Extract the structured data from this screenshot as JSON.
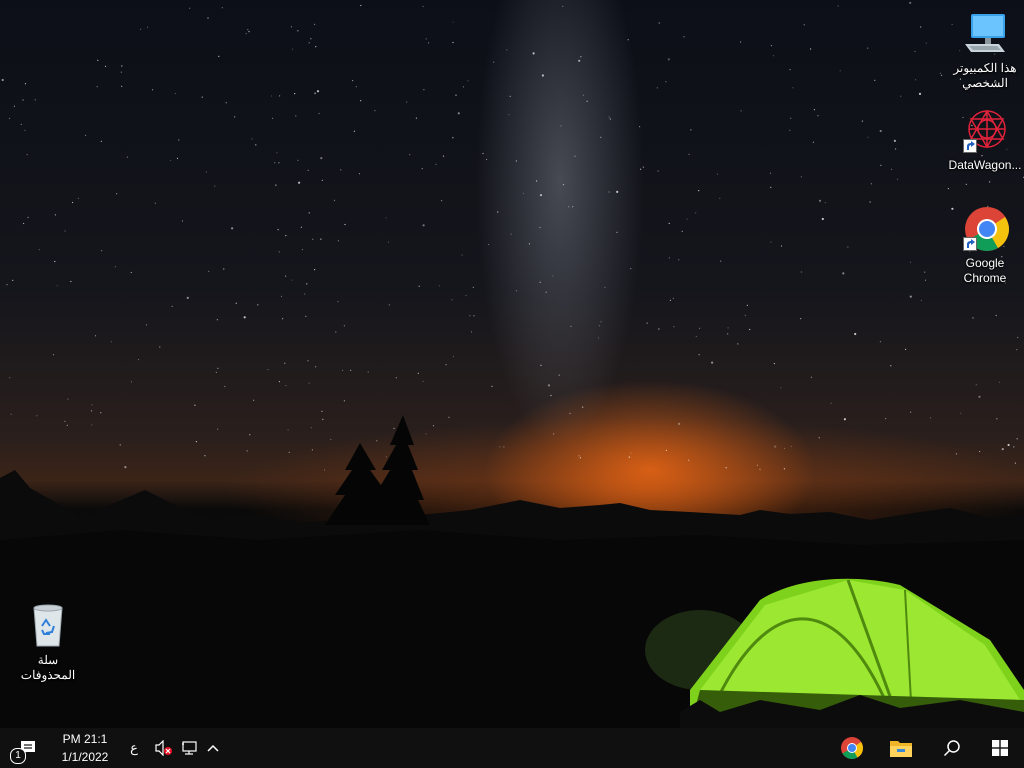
{
  "desktop": {
    "icons": [
      {
        "label": "هذا الكمبيوتر الشخصي",
        "icon": "this-pc-icon"
      },
      {
        "label": "DataWagon...",
        "icon": "datawagon-icon"
      },
      {
        "label": "Google Chrome",
        "icon": "chrome-icon"
      },
      {
        "label": "سلة المحذوفات",
        "icon": "recycle-bin-icon"
      }
    ]
  },
  "taskbar": {
    "clock": {
      "time": "PM 21:1",
      "date": "1/1/2022"
    },
    "language": "ع",
    "notification_badge": "1",
    "tray_icons": [
      "action-center-icon",
      "volume-muted-icon",
      "network-icon",
      "chevron-up-icon"
    ],
    "pinned": [
      "chrome-icon",
      "file-explorer-icon",
      "search-icon",
      "windows-start-icon"
    ]
  },
  "colors": {
    "taskbar_bg": "#101010",
    "tent_green": "#8fe22a",
    "horizon_orange": "#ff6a14"
  }
}
